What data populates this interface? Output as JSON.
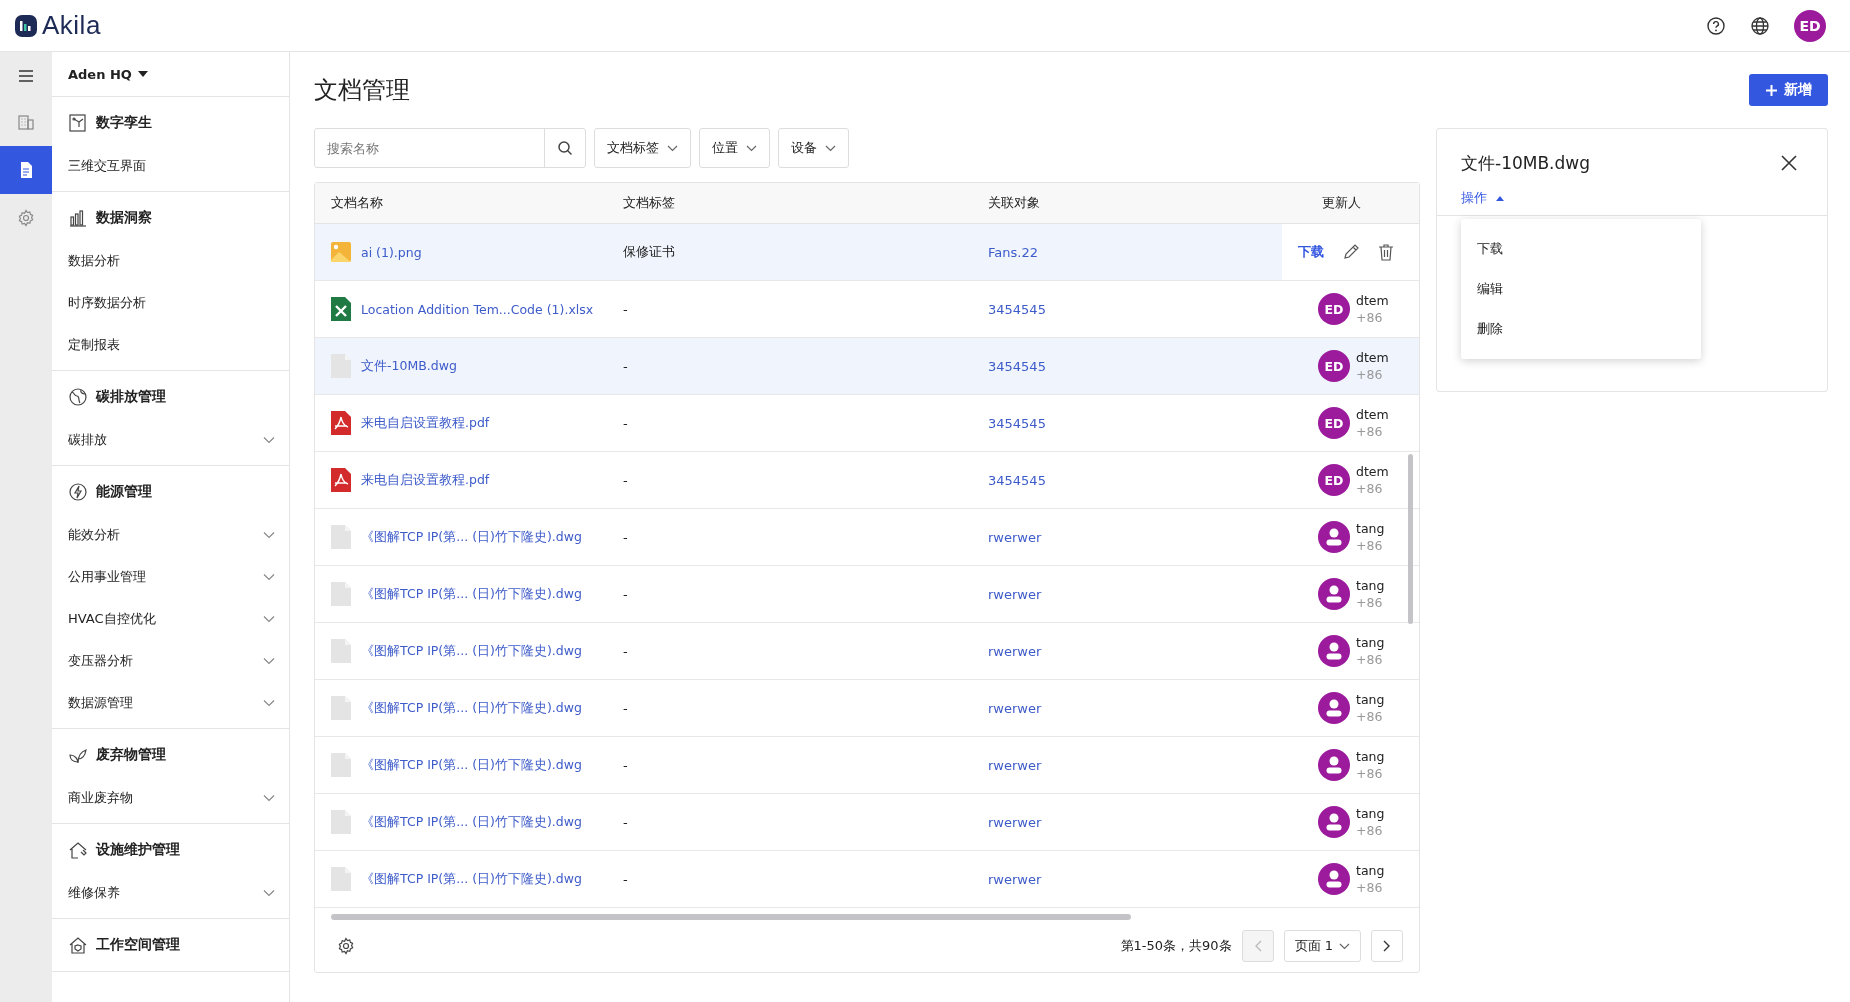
{
  "header": {
    "logo": "Akila",
    "avatar": "ED"
  },
  "rail": [
    {
      "selected": false
    },
    {
      "selected": true
    },
    {
      "selected": false
    }
  ],
  "sidebar": {
    "site": "Aden HQ",
    "sections": [
      {
        "title": "数字孪生",
        "items": [
          {
            "label": "三维交互界面",
            "expandable": false
          }
        ]
      },
      {
        "title": "数据洞察",
        "items": [
          {
            "label": "数据分析",
            "expandable": false
          },
          {
            "label": "时序数据分析",
            "expandable": false
          },
          {
            "label": "定制报表",
            "expandable": false
          }
        ]
      },
      {
        "title": "碳排放管理",
        "items": [
          {
            "label": "碳排放",
            "expandable": true
          }
        ]
      },
      {
        "title": "能源管理",
        "items": [
          {
            "label": "能效分析",
            "expandable": true
          },
          {
            "label": "公用事业管理",
            "expandable": true
          },
          {
            "label": "HVAC自控优化",
            "expandable": true
          },
          {
            "label": "变压器分析",
            "expandable": true
          },
          {
            "label": "数据源管理",
            "expandable": true
          }
        ]
      },
      {
        "title": "废弃物管理",
        "items": [
          {
            "label": "商业废弃物",
            "expandable": true
          }
        ]
      },
      {
        "title": "设施维护管理",
        "items": [
          {
            "label": "维修保养",
            "expandable": true
          }
        ]
      },
      {
        "title": "工作空间管理"
      }
    ]
  },
  "page": {
    "title": "文档管理",
    "add_button": "新增"
  },
  "filters": {
    "search": {
      "placeholder": "搜索名称"
    },
    "dropdowns": [
      "文档标签",
      "位置",
      "设备"
    ]
  },
  "table": {
    "columns": [
      "文档名称",
      "文档标签",
      "关联对象",
      "更新人"
    ],
    "rows": [
      {
        "kind": "image",
        "name": "ai (1).png",
        "tag": "保修证书",
        "related": "Fans.22",
        "selected": true,
        "actions": {
          "download": "下载"
        }
      },
      {
        "kind": "excel",
        "name": "Location Addition Tem...Code (1).xlsx",
        "tag": "-",
        "related": "3454545",
        "selected": false,
        "user": {
          "kind": "initials",
          "initials": "ED",
          "name": "dtem",
          "phone": "+86"
        }
      },
      {
        "kind": "file",
        "name": "文件-10MB.dwg",
        "tag": "-",
        "related": "3454545",
        "selected": true,
        "user": {
          "kind": "initials",
          "initials": "ED",
          "name": "dtem",
          "phone": "+86"
        }
      },
      {
        "kind": "pdf",
        "name": "来电自启设置教程.pdf",
        "tag": "-",
        "related": "3454545",
        "selected": false,
        "user": {
          "kind": "initials",
          "initials": "ED",
          "name": "dtem",
          "phone": "+86"
        }
      },
      {
        "kind": "pdf",
        "name": "来电自启设置教程.pdf",
        "tag": "-",
        "related": "3454545",
        "selected": false,
        "user": {
          "kind": "initials",
          "initials": "ED",
          "name": "dtem",
          "phone": "+86"
        }
      },
      {
        "kind": "file",
        "name": "《图解TCP IP(第... (日)竹下隆史).dwg",
        "tag": "-",
        "related": "rwerwer",
        "selected": false,
        "user": {
          "kind": "person",
          "name": "tang",
          "phone": "+86"
        }
      },
      {
        "kind": "file",
        "name": "《图解TCP IP(第... (日)竹下隆史).dwg",
        "tag": "-",
        "related": "rwerwer",
        "selected": false,
        "user": {
          "kind": "person",
          "name": "tang",
          "phone": "+86"
        }
      },
      {
        "kind": "file",
        "name": "《图解TCP IP(第... (日)竹下隆史).dwg",
        "tag": "-",
        "related": "rwerwer",
        "selected": false,
        "user": {
          "kind": "person",
          "name": "tang",
          "phone": "+86"
        }
      },
      {
        "kind": "file",
        "name": "《图解TCP IP(第... (日)竹下隆史).dwg",
        "tag": "-",
        "related": "rwerwer",
        "selected": false,
        "user": {
          "kind": "person",
          "name": "tang",
          "phone": "+86"
        }
      },
      {
        "kind": "file",
        "name": "《图解TCP IP(第... (日)竹下隆史).dwg",
        "tag": "-",
        "related": "rwerwer",
        "selected": false,
        "user": {
          "kind": "person",
          "name": "tang",
          "phone": "+86"
        }
      },
      {
        "kind": "file",
        "name": "《图解TCP IP(第... (日)竹下隆史).dwg",
        "tag": "-",
        "related": "rwerwer",
        "selected": false,
        "user": {
          "kind": "person",
          "name": "tang",
          "phone": "+86"
        }
      },
      {
        "kind": "file",
        "name": "《图解TCP IP(第... (日)竹下隆史).dwg",
        "tag": "-",
        "related": "rwerwer",
        "selected": false,
        "user": {
          "kind": "person",
          "name": "tang",
          "phone": "+86"
        }
      }
    ],
    "pagination": {
      "summary": "第1-50条，共90条",
      "page": "页面 1"
    }
  },
  "detail": {
    "title": "文件-10MB.dwg",
    "actions_label": "操作",
    "expanded": true,
    "menu": [
      "下载",
      "编辑",
      "删除"
    ]
  }
}
